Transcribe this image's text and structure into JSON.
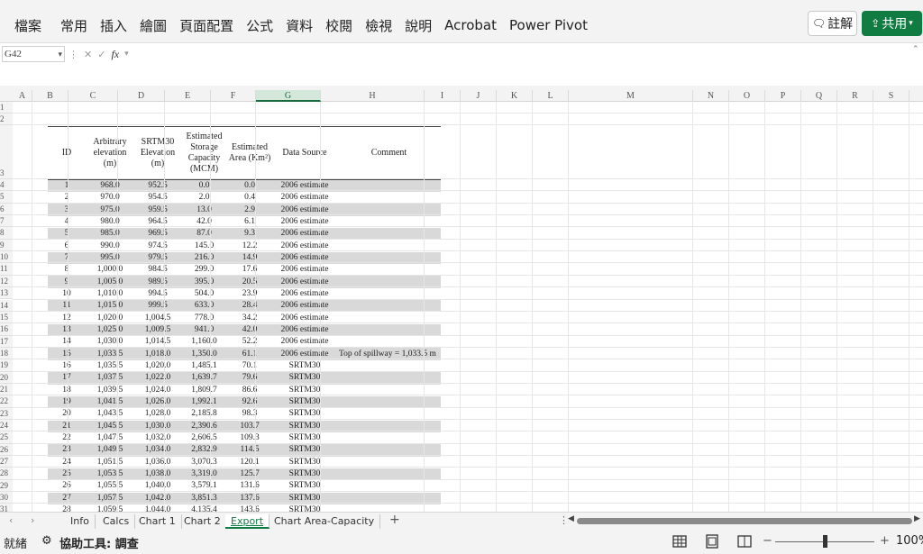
{
  "ribbon": {
    "menu": [
      "檔案",
      "常用",
      "插入",
      "繪圖",
      "頁面配置",
      "公式",
      "資料",
      "校閱",
      "檢視",
      "說明",
      "Acrobat",
      "Power Pivot"
    ],
    "comment_label": "註解",
    "share_label": "共用"
  },
  "formula_bar": {
    "name_box": "G42",
    "fx_label": "fx",
    "content": ""
  },
  "columns": [
    "A",
    "B",
    "C",
    "D",
    "E",
    "F",
    "G",
    "H",
    "I",
    "J",
    "K",
    "L",
    "M",
    "N",
    "O",
    "P",
    "Q",
    "R",
    "S"
  ],
  "selected_column": "G",
  "rows": [
    "1",
    "2",
    "3",
    "4",
    "5",
    "6",
    "7",
    "8",
    "9",
    "10",
    "11",
    "12",
    "13",
    "14",
    "15",
    "16",
    "17",
    "18",
    "19",
    "20",
    "21",
    "22",
    "23",
    "24",
    "25",
    "26",
    "27",
    "28",
    "29",
    "30",
    "31"
  ],
  "table": {
    "headers": [
      "ID",
      "Arbitrary elevation (m)",
      "SRTM30 Elevation (m)",
      "Estimated Storage Capacity (MCM)",
      "Estimated Area (Km²)",
      "Data Source",
      "Comment"
    ],
    "rows": [
      [
        "1",
        "968.0",
        "952.5",
        "0.0",
        "0.0",
        "2006 estimate",
        ""
      ],
      [
        "2",
        "970.0",
        "954.5",
        "2.0",
        "0.4",
        "2006 estimate",
        ""
      ],
      [
        "3",
        "975.0",
        "959.5",
        "13.0",
        "2.9",
        "2006 estimate",
        ""
      ],
      [
        "4",
        "980.0",
        "964.5",
        "42.0",
        "6.1",
        "2006 estimate",
        ""
      ],
      [
        "5",
        "985.0",
        "969.5",
        "87.0",
        "9.3",
        "2006 estimate",
        ""
      ],
      [
        "6",
        "990.0",
        "974.5",
        "145.0",
        "12.2",
        "2006 estimate",
        ""
      ],
      [
        "7",
        "995.0",
        "979.5",
        "216.0",
        "14.9",
        "2006 estimate",
        ""
      ],
      [
        "8",
        "1,000.0",
        "984.5",
        "299.0",
        "17.6",
        "2006 estimate",
        ""
      ],
      [
        "9",
        "1,005.0",
        "989.5",
        "395.0",
        "20.5",
        "2006 estimate",
        ""
      ],
      [
        "10",
        "1,010.0",
        "994.5",
        "504.0",
        "23.9",
        "2006 estimate",
        ""
      ],
      [
        "11",
        "1,015.0",
        "999.5",
        "633.0",
        "28.4",
        "2006 estimate",
        ""
      ],
      [
        "12",
        "1,020.0",
        "1,004.5",
        "778.0",
        "34.2",
        "2006 estimate",
        ""
      ],
      [
        "13",
        "1,025.0",
        "1,009.5",
        "941.0",
        "42.0",
        "2006 estimate",
        ""
      ],
      [
        "14",
        "1,030.0",
        "1,014.5",
        "1,160.0",
        "52.2",
        "2006 estimate",
        ""
      ],
      [
        "15",
        "1,033.5",
        "1,018.0",
        "1,350.0",
        "61.1",
        "2006 estimate",
        "Top of spillway = 1,033.5 m"
      ],
      [
        "16",
        "1,035.5",
        "1,020.0",
        "1,485.1",
        "70.1",
        "SRTM30",
        ""
      ],
      [
        "17",
        "1,037.5",
        "1,022.0",
        "1,639.7",
        "79.6",
        "SRTM30",
        ""
      ],
      [
        "18",
        "1,039.5",
        "1,024.0",
        "1,809.7",
        "86.6",
        "SRTM30",
        ""
      ],
      [
        "19",
        "1,041.5",
        "1,026.0",
        "1,992.1",
        "92.6",
        "SRTM30",
        ""
      ],
      [
        "20",
        "1,043.5",
        "1,028.0",
        "2,185.8",
        "98.3",
        "SRTM30",
        ""
      ],
      [
        "21",
        "1,045.5",
        "1,030.0",
        "2,390.6",
        "103.7",
        "SRTM30",
        ""
      ],
      [
        "22",
        "1,047.5",
        "1,032.0",
        "2,606.5",
        "109.3",
        "SRTM30",
        ""
      ],
      [
        "23",
        "1,049.5",
        "1,034.0",
        "2,832.9",
        "114.5",
        "SRTM30",
        ""
      ],
      [
        "24",
        "1,051.5",
        "1,036.0",
        "3,070.3",
        "120.1",
        "SRTM30",
        ""
      ],
      [
        "25",
        "1,053.5",
        "1,038.0",
        "3,319.0",
        "125.7",
        "SRTM30",
        ""
      ],
      [
        "26",
        "1,055.5",
        "1,040.0",
        "3,579.1",
        "131.6",
        "SRTM30",
        ""
      ],
      [
        "27",
        "1,057.5",
        "1,042.0",
        "3,851.3",
        "137.6",
        "SRTM30",
        ""
      ],
      [
        "28",
        "1,059.5",
        "1,044.0",
        "4,135.4",
        "143.6",
        "SRTM30",
        ""
      ]
    ]
  },
  "sheets": {
    "nav_prev": "‹",
    "nav_next": "›",
    "tabs": [
      "Info",
      "Calcs",
      "Chart 1",
      "Chart 2",
      "Export",
      "Chart Area-Capacity"
    ],
    "active": "Export",
    "add": "+"
  },
  "status": {
    "ready": "就緒",
    "accessibility": "協助工具: 調查",
    "zoom": "100%"
  }
}
